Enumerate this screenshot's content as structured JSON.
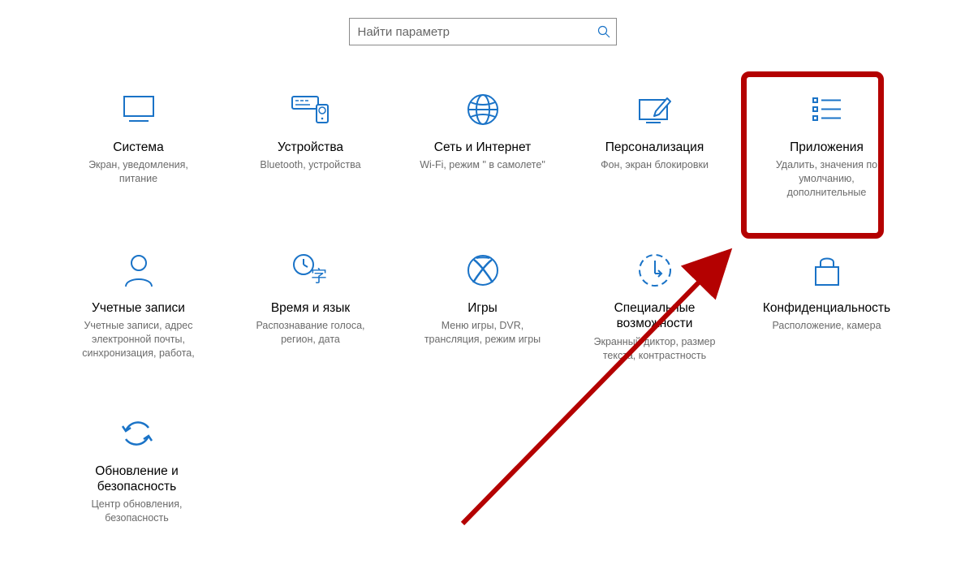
{
  "search": {
    "placeholder": "Найти параметр"
  },
  "accent": "#1a73c7",
  "tiles": {
    "system": {
      "title": "Система",
      "desc": "Экран, уведомления, питание"
    },
    "devices": {
      "title": "Устройства",
      "desc": "Bluetooth, устройства"
    },
    "network": {
      "title": "Сеть и Интернет",
      "desc": "Wi-Fi, режим \" в самолете\""
    },
    "personalization": {
      "title": "Персонализация",
      "desc": "Фон, экран блокировки"
    },
    "apps": {
      "title": "Приложения",
      "desc": "Удалить, значения по умолчанию, дополнительные"
    },
    "accounts": {
      "title": "Учетные записи",
      "desc": "Учетные записи, адрес электронной почты, синхронизация, работа,"
    },
    "timelang": {
      "title": "Время и язык",
      "desc": "Распознавание голоса, регион, дата"
    },
    "gaming": {
      "title": "Игры",
      "desc": "Меню игры, DVR, трансляция, режим игры"
    },
    "ease": {
      "title": "Специальные возможности",
      "desc": "Экранный диктор, размер текста, контрастность"
    },
    "privacy": {
      "title": "Конфиденциальность",
      "desc": "Расположение, камера"
    },
    "update": {
      "title": "Обновление и безопасность",
      "desc": "Центр обновления, безопасность"
    }
  },
  "highlight": {
    "target": "apps"
  }
}
